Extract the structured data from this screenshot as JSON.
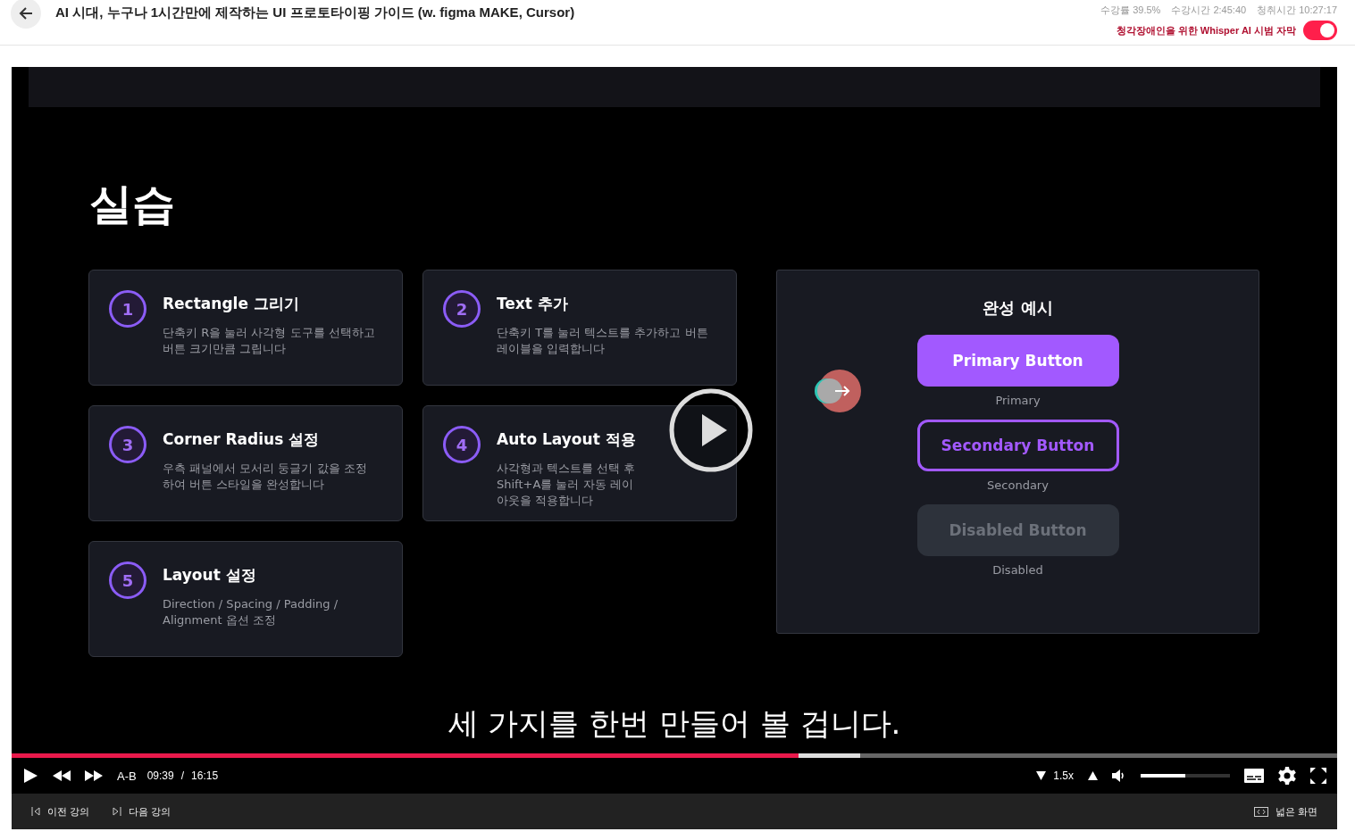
{
  "header": {
    "title": "AI 시대, 누구나 1시간만에 제작하는 UI 프로토타이핑 가이드 (w. figma MAKE, Cursor)",
    "stats": [
      "수강률 39.5%",
      "수강시간 2:45:40",
      "청취시간 10:27:17"
    ],
    "subtitle_toggle": {
      "label": "청각장애인을 위한 Whisper AI 시범 자막",
      "on": true
    }
  },
  "slide": {
    "title": "실습",
    "steps": [
      {
        "number": "1",
        "title": "Rectangle 그리기",
        "description": "단축키 R을 눌러 사각형 도구를 선택하고 버튼 크기만큼 그립니다"
      },
      {
        "number": "2",
        "title": "Text 추가",
        "description": "단축키 T를 눌러 텍스트를 추가하고 버튼 레이블을 입력합니다"
      },
      {
        "number": "3",
        "title": "Corner Radius 설정",
        "description": "우측 패널에서 모서리 둥글기 값을 조정하여 버튼 스타일을 완성합니다"
      },
      {
        "number": "4",
        "title": "Auto Layout 적용",
        "description": "사각형과 텍스트를 선택 후 Shift+A를 눌러 자동 레이아웃을 적용합니다"
      },
      {
        "number": "5",
        "title": "Layout 설정",
        "description": "Direction / Spacing / Padding / Alignment 옵션 조정"
      }
    ],
    "example": {
      "title": "완성 예시",
      "buttons": [
        {
          "kind": "primary",
          "label": "Primary Button",
          "caption": "Primary"
        },
        {
          "kind": "secondary",
          "label": "Secondary Button",
          "caption": "Secondary"
        },
        {
          "kind": "disabled",
          "label": "Disabled Button",
          "caption": "Disabled"
        }
      ]
    }
  },
  "caption": "세 가지를 한번 만들어 볼 겁니다.",
  "player": {
    "progress": {
      "level": 0.594
    },
    "buffered": {
      "level": 0.64
    },
    "ab_label": "A-B",
    "current_time": "09:39",
    "separator": "/",
    "duration": "16:15",
    "speed": "1.5x",
    "volume": {
      "level": 0.5
    }
  },
  "bottom_bar": {
    "prev": "이전 강의",
    "next": "다음 강의",
    "wide": "넓은 화면"
  }
}
